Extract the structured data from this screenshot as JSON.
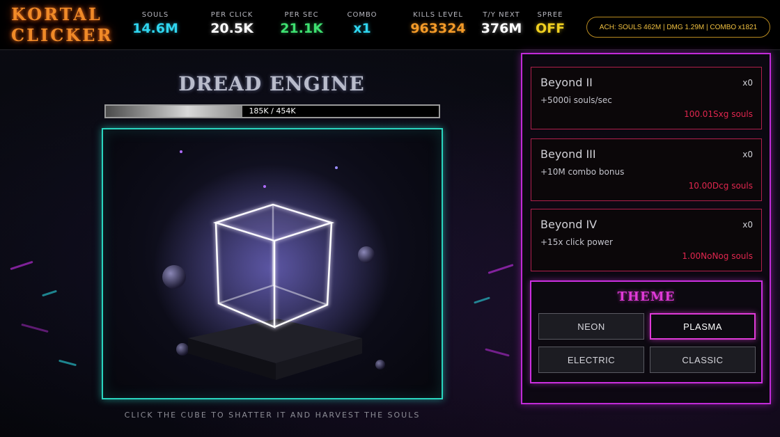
{
  "game": {
    "title_line1": "KORTAL",
    "title_line2": "CLICKER"
  },
  "stats": [
    {
      "label": "SOULS",
      "value": "14.6M",
      "color": "#2fd6f0"
    },
    {
      "label": "PER CLICK",
      "value": "20.5K",
      "color": "#ffffff"
    },
    {
      "label": "PER SEC",
      "value": "21.1K",
      "color": "#3ee070"
    },
    {
      "label": "COMBO",
      "value": "x1",
      "color": "#2fd6f0"
    },
    {
      "label": "KILLS LEVEL",
      "value": "963324",
      "color": "#f39a28"
    },
    {
      "label": "T/Y NEXT",
      "value": "376M",
      "color": "#ffffff"
    },
    {
      "label": "SPREE",
      "value": "OFF",
      "color": "#f0d020"
    }
  ],
  "achievements": "ACH: SOULS 462M | DMG 1.29M | COMBO x1821",
  "boss": {
    "name": "DREAD ENGINE",
    "hp_text": "185K / 454K",
    "hp_fraction": 0.41
  },
  "hint": "CLICK THE CUBE TO SHATTER IT AND HARVEST THE SOULS",
  "upgrades": [
    {
      "name": "Beyond II",
      "count": "x0",
      "desc": "+5000i souls/sec",
      "cost": "100.01Sxg souls"
    },
    {
      "name": "Beyond III",
      "count": "x0",
      "desc": "+10M combo bonus",
      "cost": "10.00Dcg souls"
    },
    {
      "name": "Beyond IV",
      "count": "x0",
      "desc": "+15x click power",
      "cost": "1.00NoNog souls"
    }
  ],
  "theme": {
    "title": "THEME",
    "options": [
      "NEON",
      "PLASMA",
      "ELECTRIC",
      "CLASSIC"
    ],
    "selected": "PLASMA"
  },
  "colors": {
    "arena_border": "#2ad6c0",
    "panel_border": "#c12bd8",
    "upgrade_cost": "#e0264e"
  }
}
